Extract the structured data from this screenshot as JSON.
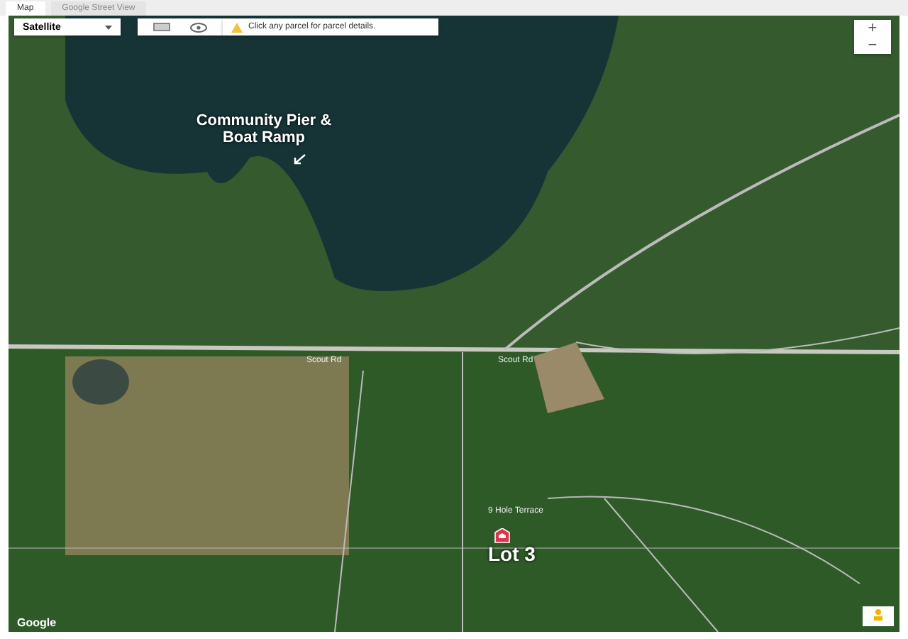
{
  "tabs": [
    {
      "label": "Map",
      "selected": true
    },
    {
      "label": "Google Street View",
      "selected": false
    }
  ],
  "map": {
    "type_selector": {
      "value": "Satellite"
    },
    "notice": "Click any parcel for parcel details.",
    "labels": [
      {
        "text": "Community Pier & Boat Ramp",
        "kind": "callout"
      },
      {
        "text": "Scout Rd",
        "kind": "road"
      },
      {
        "text": "Scout Rd",
        "kind": "road"
      },
      {
        "text": "9 Hole Terrace",
        "kind": "road"
      },
      {
        "text": "Lot 3",
        "kind": "lot"
      }
    ],
    "zoom_in": "+",
    "zoom_out": "−",
    "logo": "Google"
  }
}
